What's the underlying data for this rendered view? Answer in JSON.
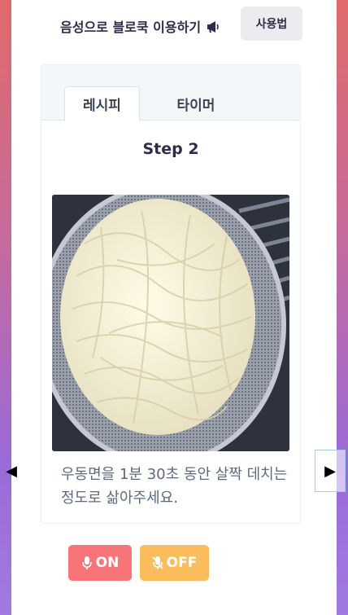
{
  "header": {
    "voice_title": "음성으로 블로쿡 이용하기",
    "megaphone_icon": "megaphone-icon",
    "help_label": "사용법"
  },
  "tabs": [
    {
      "label": "레시피",
      "active": true
    },
    {
      "label": "타이머",
      "active": false
    }
  ],
  "step": {
    "title": "Step 2",
    "image": "udon-noodles-in-strainer",
    "description": "우동면을 1분 30초 동안 살짝 데치는 정도로 삶아주세요."
  },
  "navigation": {
    "prev_icon": "◀",
    "next_icon": "▶"
  },
  "mic_controls": {
    "on_label": "ON",
    "off_label": "OFF",
    "on_color": "#f77479",
    "off_color": "#fbbc5b"
  }
}
